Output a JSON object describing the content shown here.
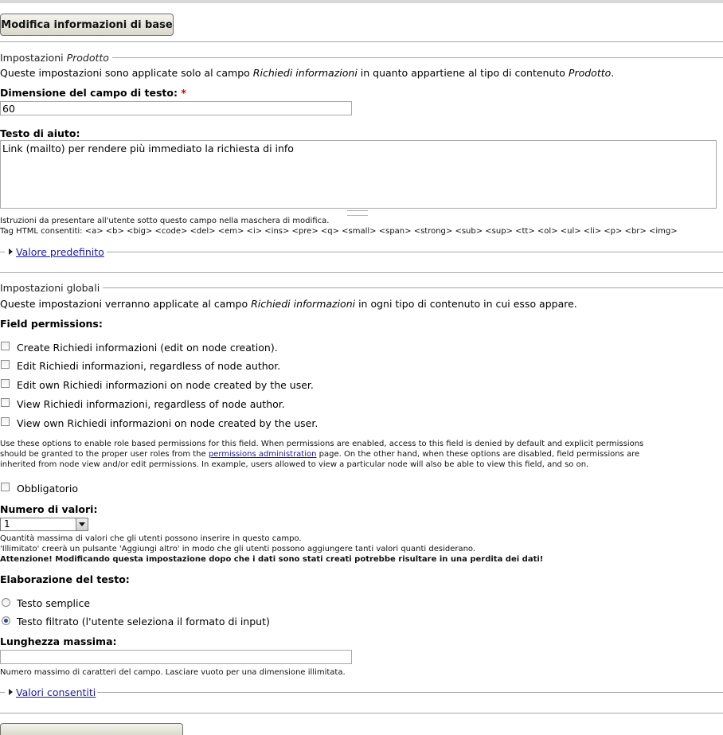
{
  "edit_basic_button": "Modifica informazioni di base",
  "product_settings": {
    "legend_prefix": "Impostazioni ",
    "legend_type": "Prodotto",
    "desc_prefix": "Queste impostazioni sono applicate solo al campo ",
    "desc_field": "Richiedi informazioni",
    "desc_mid": " in quanto appartiene al tipo di contenuto ",
    "desc_type": "Prodotto",
    "desc_end": ".",
    "size_label": "Dimensione del campo di testo:",
    "required_mark": "*",
    "size_value": "60",
    "help_label": "Testo di aiuto:",
    "help_value": "Link (mailto) per rendere più immediato la richiesta di info",
    "help_desc": "Istruzioni da presentare all'utente sotto questo campo nella maschera di modifica.",
    "help_tags": "Tag HTML consentiti: <a> <b> <big> <code> <del> <em> <i> <ins> <pre> <q> <small> <span> <strong> <sub> <sup> <tt> <ol> <ul> <li> <p> <br> <img>",
    "default_value_link": "Valore predefinito"
  },
  "global_settings": {
    "legend": "Impostazioni globali",
    "desc_prefix": "Queste impostazioni verranno applicate al campo ",
    "desc_field": "Richiedi informazioni",
    "desc_end": " in ogni tipo di contenuto in cui esso appare.",
    "permissions_label": "Field permissions:",
    "permissions": [
      {
        "label": "Create Richiedi informazioni (edit on node creation).",
        "checked": false
      },
      {
        "label": "Edit Richiedi informazioni, regardless of node author.",
        "checked": false
      },
      {
        "label": "Edit own Richiedi informazioni on node created by the user.",
        "checked": false
      },
      {
        "label": "View Richiedi informazioni, regardless of node author.",
        "checked": false
      },
      {
        "label": "View own Richiedi informazioni on node created by the user.",
        "checked": false
      }
    ],
    "perm_desc_1": "Use these options to enable role based permissions for this field. When permissions are enabled, access to this field is denied by default and explicit permissions",
    "perm_desc_2a": "should be granted to the proper user roles from the ",
    "perm_desc_link": "permissions administration",
    "perm_desc_2b": " page. On the other hand, when these options are disabled, field permissions are",
    "perm_desc_3": "inherited from node view and/or edit permissions. In example, users allowed to view a particular node will also be able to view this field, and so on.",
    "required_label": "Obbligatorio",
    "count_label": "Numero di valori:",
    "count_value": "1",
    "count_desc_1": "Quantità massima di valori che gli utenti possono inserire in questo campo.",
    "count_desc_2": "'Illimitato' creerà un pulsante 'Aggiungi altro' in modo che gli utenti possono aggiungere tanti valori quanti desiderano.",
    "count_warning": "Attenzione! Modificando questa impostazione dopo che i dati sono stati creati potrebbe risultare in una perdita dei dati!",
    "text_processing_label": "Elaborazione del testo:",
    "text_processing_options": [
      {
        "label": "Testo semplice",
        "selected": false
      },
      {
        "label": "Testo filtrato (l'utente seleziona il formato di input)",
        "selected": true
      }
    ],
    "max_length_label": "Lunghezza massima:",
    "max_length_value": "",
    "max_length_desc": "Numero massimo di caratteri del campo. Lasciare vuoto per una dimensione illimitata.",
    "allowed_values_link": "Valori consentiti"
  }
}
